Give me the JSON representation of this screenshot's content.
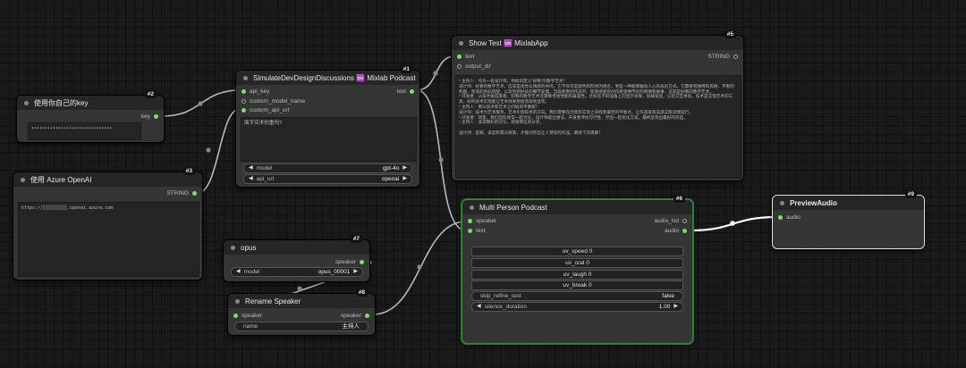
{
  "nodes": {
    "key": {
      "title": "使用你自己的key",
      "badge": "#2",
      "out": "key",
      "value": "••••••••••••••••••••••••••••••"
    },
    "azure": {
      "title": "使用 Azure OpenAI",
      "badge": "#3",
      "out": "STRING",
      "value": "https://░░░░░░░░░.openai.azure.com"
    },
    "sim": {
      "title": "SimulateDevDesignDiscussions ♾️ Mixlab Podcast",
      "badge": "#1",
      "in": [
        "api_key",
        "custom_model_name",
        "custom_api_url"
      ],
      "out": "text",
      "prompt": "面字实术的重吗?",
      "w_model_label": "model",
      "w_model_value": "gpt-4o",
      "w_api_label": "api_url",
      "w_api_value": "openai"
    },
    "show": {
      "title": "Show Text ♾️ MixlabApp",
      "badge": "#5",
      "in": [
        "text",
        "output_dir"
      ],
      "out": "STRING",
      "text": "* 主持人：作为一名设计师，你如何定义“好看”的数字艺术？\n设计师：好看的数字艺术，应该是视觉与情感的共鸣。它不仅仅是颜色和形状的组合，更是一种能够触动人心的表达方式。它需要有独特的风格、平衡的构图、和谐的色彩搭配，以及恰到好处的细节处理。当观者看到作品时，能够感受到创作者想要传达的情绪和故事，这就是好看的数字艺术。\n* 开发者：从技术角度来看，好看的数字艺术还需要考虑性能和兼容性。比如在不同设备上的显示效果，加载速度，以及交互体验。技术是实现艺术的工具，好的技术实现能让艺术效果更加完美地呈现。\n* 主持人：那么技术和艺术之间如何平衡呢？\n设计师：技术为艺术服务，艺术引领技术的方向。我们需要在创意和实现之间找到最佳的平衡点，让作品既有美感又能流畅运行。\n* 开发者：同意。我们团队经常一起讨论，设计师提出想法，开发者评估可行性，然后一起优化方案，最终呈现出最好的作品。\n* 主持人：非常精彩的讨论，感谢两位的分享。\n\n设计师：是啊，美是积累与探索，才能创作出让人赞叹的作品。期待下次再聊！"
    },
    "multi": {
      "title": "Multi Person Podcast",
      "badge": "#6",
      "in": [
        "speaker",
        "text"
      ],
      "out": [
        "audio_list",
        "audio"
      ],
      "w1": "uv_speed 0",
      "w2": "uv_oral 0",
      "w3": "uv_laugh 0",
      "w4": "uv_break 0",
      "w5_label": "skip_refine_text",
      "w5_value": "false",
      "w6_label": "silence_duration",
      "w6_value": "1.00"
    },
    "preview": {
      "title": "PreviewAudio",
      "badge": "#9",
      "in": "audio"
    },
    "opus": {
      "title": "opus",
      "badge": "#7",
      "out": "speaker",
      "w_label": "model",
      "w_value": "opus_00001"
    },
    "rename": {
      "title": "Rename Speaker",
      "badge": "#8",
      "in": "speaker",
      "out": "speaker",
      "w_label": "name",
      "w_value": "主持人"
    }
  },
  "colors": {
    "wire": "#c8c8c8",
    "slot": "#7ddc6b",
    "selected": "#2e8b3a"
  }
}
